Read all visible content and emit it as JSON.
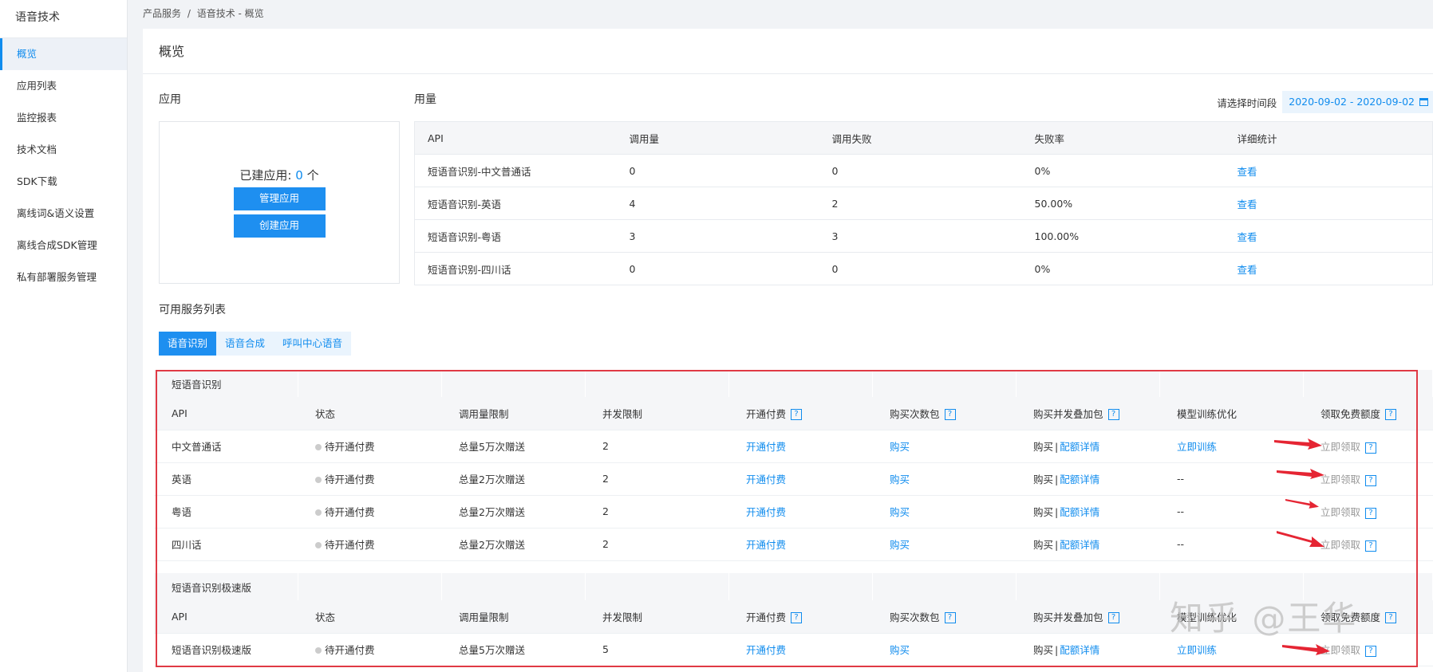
{
  "sidebar": {
    "title": "语音技术",
    "items": [
      {
        "label": "概览",
        "active": true
      },
      {
        "label": "应用列表"
      },
      {
        "label": "监控报表"
      },
      {
        "label": "技术文档"
      },
      {
        "label": "SDK下载"
      },
      {
        "label": "离线词&语义设置"
      },
      {
        "label": "离线合成SDK管理"
      },
      {
        "label": "私有部署服务管理"
      }
    ]
  },
  "breadcrumb": {
    "parent": "产品服务",
    "separator": "/",
    "current": "语音技术 - 概览"
  },
  "page_title": "概览",
  "app_section": {
    "label": "应用",
    "count_prefix": "已建应用: ",
    "count": "0",
    "count_suffix": " 个",
    "manage_button": "管理应用",
    "create_button": "创建应用"
  },
  "usage": {
    "label": "用量",
    "date_label": "请选择时间段",
    "date_range": "2020-09-02 - 2020-09-02",
    "headers": [
      "API",
      "调用量",
      "调用失败",
      "失败率",
      "详细统计"
    ],
    "rows": [
      {
        "api": "短语音识别-中文普通话",
        "calls": "0",
        "fails": "0",
        "rate": "0%",
        "detail": "查看"
      },
      {
        "api": "短语音识别-英语",
        "calls": "4",
        "fails": "2",
        "rate": "50.00%",
        "detail": "查看"
      },
      {
        "api": "短语音识别-粤语",
        "calls": "3",
        "fails": "3",
        "rate": "100.00%",
        "detail": "查看"
      },
      {
        "api": "短语音识别-四川话",
        "calls": "0",
        "fails": "0",
        "rate": "0%",
        "detail": "查看"
      }
    ]
  },
  "services": {
    "label": "可用服务列表",
    "tabs": [
      {
        "label": "语音识别",
        "active": true
      },
      {
        "label": "语音合成"
      },
      {
        "label": "呼叫中心语音"
      }
    ],
    "headers": [
      "API",
      "状态",
      "调用量限制",
      "并发限制",
      "开通付费",
      "购买次数包",
      "购买并发叠加包",
      "模型训练优化",
      "领取免费额度"
    ],
    "group1": {
      "title": "短语音识别",
      "rows": [
        {
          "api": "中文普通话",
          "status": "待开通付费",
          "limit": "总量5万次赠送",
          "concurrency": "2",
          "pay": "开通付费",
          "buy": "购买",
          "buy2": "购买",
          "quota_detail": "配额详情",
          "train": "立即训练",
          "claim": "立即领取"
        },
        {
          "api": "英语",
          "status": "待开通付费",
          "limit": "总量2万次赠送",
          "concurrency": "2",
          "pay": "开通付费",
          "buy": "购买",
          "buy2": "购买",
          "quota_detail": "配额详情",
          "train": "--",
          "claim": "立即领取"
        },
        {
          "api": "粤语",
          "status": "待开通付费",
          "limit": "总量2万次赠送",
          "concurrency": "2",
          "pay": "开通付费",
          "buy": "购买",
          "buy2": "购买",
          "quota_detail": "配额详情",
          "train": "--",
          "claim": "立即领取"
        },
        {
          "api": "四川话",
          "status": "待开通付费",
          "limit": "总量2万次赠送",
          "concurrency": "2",
          "pay": "开通付费",
          "buy": "购买",
          "buy2": "购买",
          "quota_detail": "配额详情",
          "train": "--",
          "claim": "立即领取"
        }
      ]
    },
    "group2": {
      "title": "短语音识别极速版",
      "rows": [
        {
          "api": "短语音识别极速版",
          "status": "待开通付费",
          "limit": "总量5万次赠送",
          "concurrency": "5",
          "pay": "开通付费",
          "buy": "购买",
          "buy2": "购买",
          "quota_detail": "配额详情",
          "train": "立即训练",
          "claim": "立即领取"
        }
      ]
    },
    "help_mark": "?"
  },
  "watermark": "知乎 @王华",
  "colors": {
    "accent": "#108cee",
    "button": "#1e8ff0",
    "highlight_frame": "#e03a45",
    "arrow": "#e52533"
  }
}
